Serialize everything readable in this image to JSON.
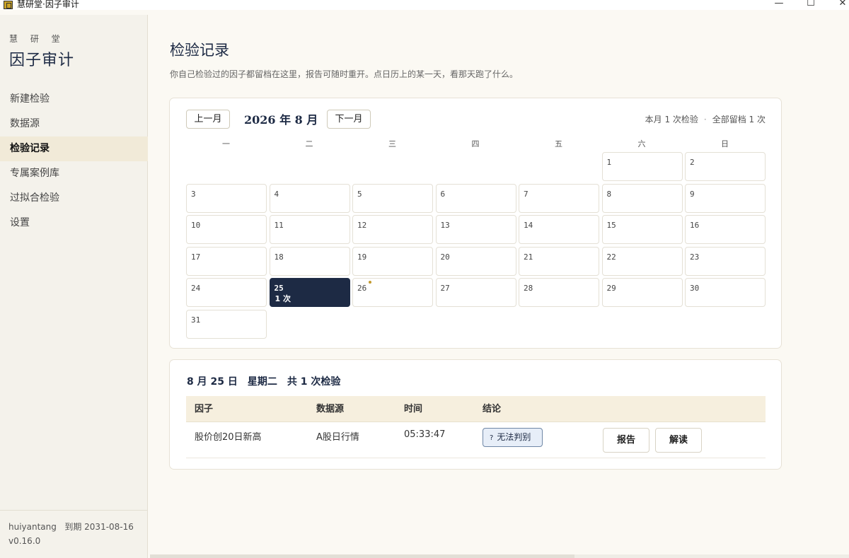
{
  "window": {
    "title": "慧研堂·因子审计",
    "min_glyph": "—",
    "max_glyph": "☐",
    "close_glyph": "✕"
  },
  "sidebar": {
    "brand_top": "慧 研 堂",
    "brand_main": "因子审计",
    "items": [
      {
        "label": "新建检验"
      },
      {
        "label": "数据源"
      },
      {
        "label": "检验记录"
      },
      {
        "label": "专属案例库"
      },
      {
        "label": "过拟合检验"
      },
      {
        "label": "设置"
      }
    ],
    "active_index": 2,
    "user": "huiyantang",
    "expiry": "到期 2031-08-16",
    "version": "v0.16.0"
  },
  "main": {
    "title": "检验记录",
    "description": "你自己检验过的因子都留档在这里，报告可随时重开。点日历上的某一天，看那天跑了什么。"
  },
  "calendar": {
    "prev_label": "上一月",
    "next_label": "下一月",
    "month_label": "2026 年 8 月",
    "summary_month": "本月 1 次检验",
    "summary_sep": "·",
    "summary_total": "全部留档 1 次",
    "weekdays": [
      "一",
      "二",
      "三",
      "四",
      "五",
      "六",
      "日"
    ],
    "first_weekday_index": 5,
    "days_in_month": 31,
    "selected_day": 25,
    "selected_count": "1 次",
    "dot_day": 26,
    "colors": {
      "selected": "#1d2a44",
      "dot": "#c39a2f"
    }
  },
  "day_detail": {
    "title": "8 月 25 日　星期二　共 1 次检验",
    "columns": [
      "因子",
      "数据源",
      "时间",
      "结论"
    ],
    "rows": [
      {
        "factor": "股价创20日新高",
        "source": "A股日行情",
        "time": "05:33:47",
        "verdict": "无法判别",
        "verdict_icon": "?",
        "report_label": "报告",
        "interpret_label": "解读"
      }
    ]
  }
}
